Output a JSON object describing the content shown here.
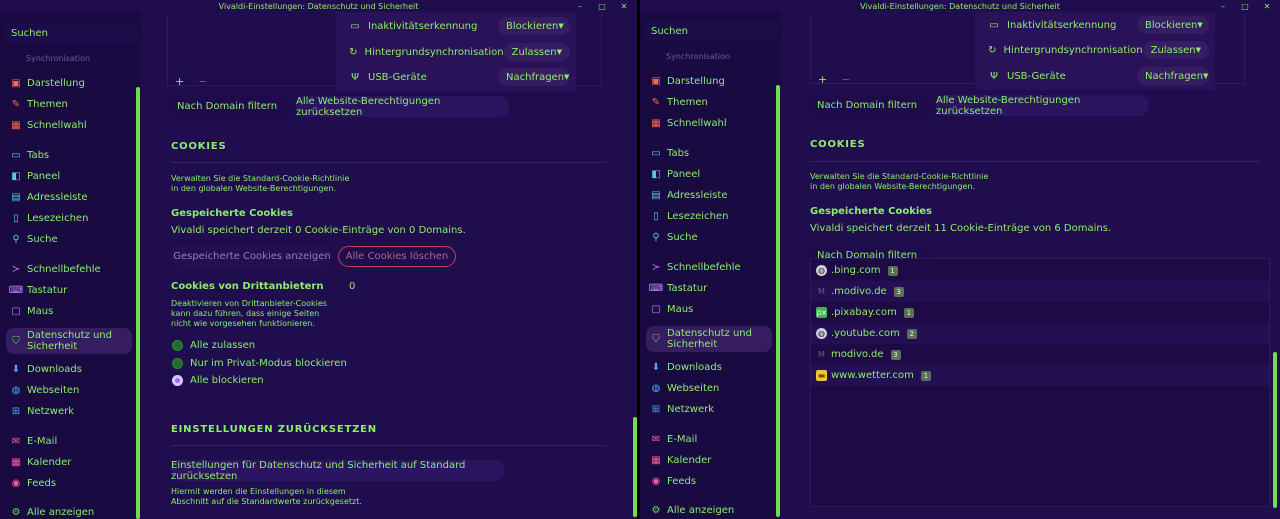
{
  "window_title": "Vivaldi-Einstellungen: Datenschutz und Sicherheit",
  "window_buttons": [
    "–",
    "□",
    "✕"
  ],
  "colors": {
    "background": "#200d4d",
    "sidebar": "#1a0a42",
    "accent": "#8bef6a",
    "scrollbar": "#6ee04c",
    "danger": "#c0405a"
  },
  "sidebar": {
    "search_placeholder": "Suchen",
    "partial_item": "Synchronisation",
    "items": [
      {
        "label": "Darstellung",
        "icon": "appearance-icon"
      },
      {
        "label": "Themen",
        "icon": "brush-icon"
      },
      {
        "label": "Schnellwahl",
        "icon": "grid-icon"
      },
      {
        "label": "Tabs",
        "icon": "tabs-icon"
      },
      {
        "label": "Paneel",
        "icon": "panel-icon"
      },
      {
        "label": "Adressleiste",
        "icon": "addressbar-icon"
      },
      {
        "label": "Lesezeichen",
        "icon": "bookmark-icon"
      },
      {
        "label": "Suche",
        "icon": "search-icon"
      },
      {
        "label": "Schnellbefehle",
        "icon": "command-icon"
      },
      {
        "label": "Tastatur",
        "icon": "keyboard-icon"
      },
      {
        "label": "Maus",
        "icon": "mouse-icon"
      },
      {
        "label": "Datenschutz und Sicherheit",
        "line1": "Datenschutz und",
        "line2": "Sicherheit",
        "icon": "shield-icon"
      },
      {
        "label": "Downloads",
        "icon": "download-icon"
      },
      {
        "label": "Webseiten",
        "icon": "globe-icon"
      },
      {
        "label": "Netzwerk",
        "icon": "network-icon"
      },
      {
        "label": "E-Mail",
        "icon": "mail-icon"
      },
      {
        "label": "Kalender",
        "icon": "calendar-icon"
      },
      {
        "label": "Feeds",
        "icon": "feeds-icon"
      },
      {
        "label": "Alle anzeigen",
        "icon": "gear-icon"
      }
    ]
  },
  "permissions": {
    "rows": [
      {
        "label": "Inaktivitätserkennung",
        "value_left": "Blockieren",
        "value_right": "Blockieren",
        "icon": "monitor-icon"
      },
      {
        "label": "Hintergrundsynchronisation",
        "value_left": "Zulassen",
        "value_right": "Zulassen",
        "icon": "sync-icon"
      },
      {
        "label": "USB-Geräte",
        "value_left": "Nachfragen",
        "value_right": "Nachfragen",
        "icon": "usb-icon"
      }
    ],
    "add": "+",
    "remove": "−",
    "filter_placeholder": "Nach Domain filtern",
    "reset_button": "Alle Website-Berechtigungen zurücksetzen"
  },
  "cookies": {
    "heading": "COOKIES",
    "desc_line1": "Verwalten Sie die Standard-Cookie-Richtlinie",
    "desc_line2": "in den globalen Website-Berechtigungen.",
    "saved_heading": "Gespeicherte Cookies",
    "saved_status_left": "Vivaldi speichert derzeit 0 Cookie-Einträge von 0 Domains.",
    "saved_status_right": "Vivaldi speichert derzeit 11 Cookie-Einträge von 6 Domains.",
    "show_button": "Gespeicherte Cookies anzeigen",
    "delete_button": "Alle Cookies löschen",
    "filter_placeholder": "Nach Domain filtern",
    "third_party_heading": "Cookies von Drittanbietern",
    "third_party_value": "0",
    "third_party_desc1": "Deaktivieren von Drittanbieter-Cookies",
    "third_party_desc2": "kann dazu führen, dass einige Seiten",
    "third_party_desc3": "nicht wie vorgesehen funktionieren.",
    "options": [
      {
        "label": "Alle zulassen",
        "selected": false
      },
      {
        "label": "Nur im Privat-Modus blockieren",
        "selected": false
      },
      {
        "label": "Alle blockieren",
        "selected": true
      }
    ],
    "domains": [
      {
        "domain": ".bing.com",
        "count": "1",
        "icon": "globe-icon"
      },
      {
        "domain": ".modivo.de",
        "count": "3",
        "icon": "modivo-icon"
      },
      {
        "domain": ".pixabay.com",
        "count": "1",
        "icon": "pixabay-icon"
      },
      {
        "domain": ".youtube.com",
        "count": "2",
        "icon": "globe-icon"
      },
      {
        "domain": "modivo.de",
        "count": "3",
        "icon": "modivo-icon"
      },
      {
        "domain": "www.wetter.com",
        "count": "1",
        "icon": "wetter-icon"
      }
    ]
  },
  "reset": {
    "heading": "EINSTELLUNGEN ZURÜCKSETZEN",
    "button": "Einstellungen für Datenschutz und Sicherheit auf Standard zurücksetzen",
    "desc1": "Hiermit werden die Einstellungen in diesem",
    "desc2": "Abschnitt auf die Standardwerte zurückgesetzt."
  }
}
